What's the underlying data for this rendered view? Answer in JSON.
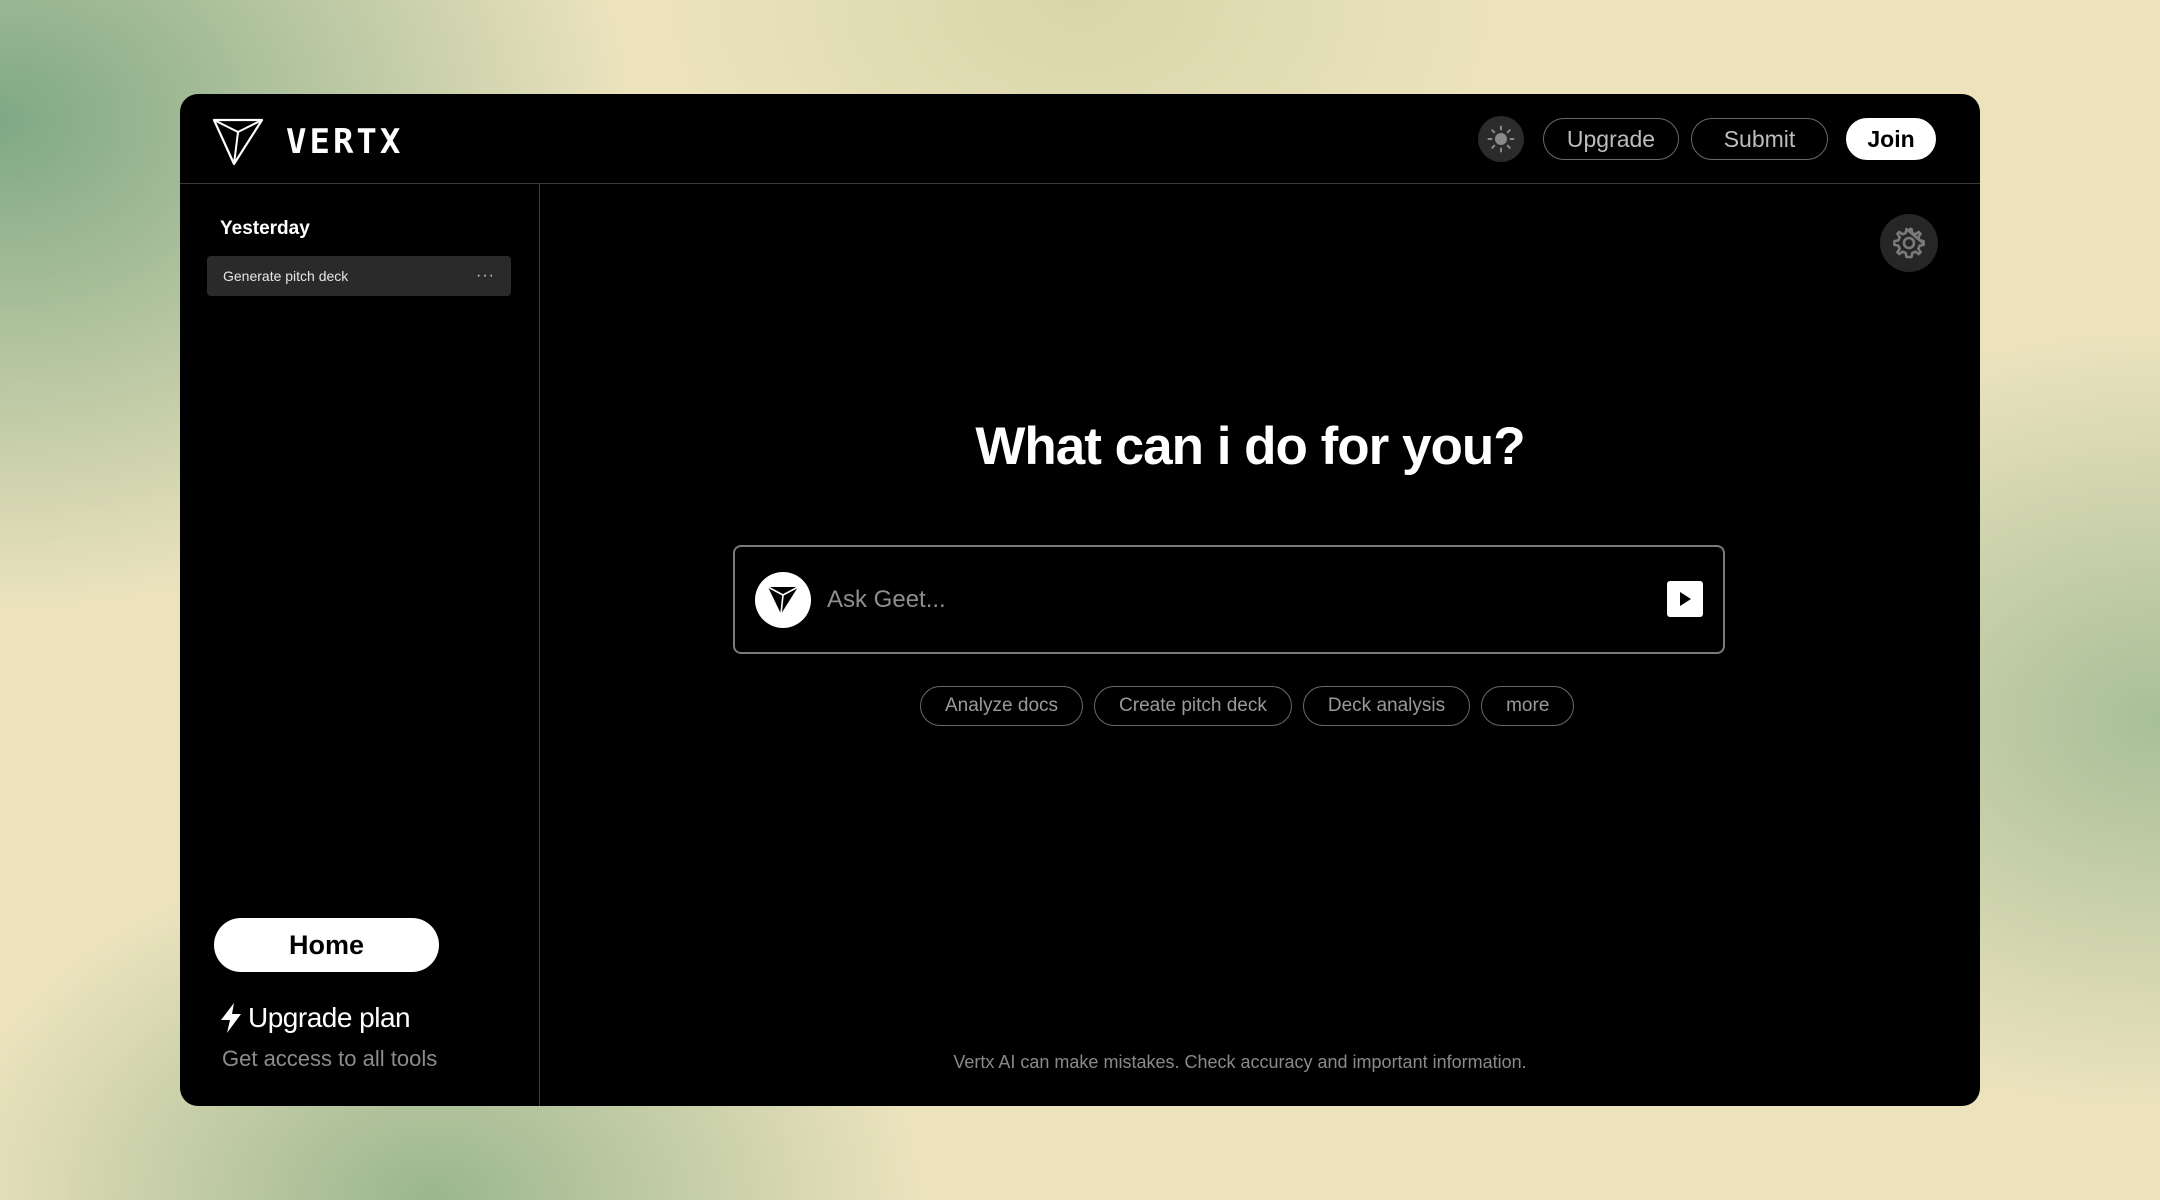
{
  "header": {
    "brand": "VERTX",
    "buttons": {
      "upgrade": "Upgrade",
      "submit": "Submit",
      "join": "Join"
    }
  },
  "sidebar": {
    "section_label": "Yesterday",
    "history": [
      {
        "label": "Generate pitch deck",
        "menu": "···"
      }
    ],
    "home_label": "Home",
    "upgrade_plan": {
      "title": "Upgrade plan",
      "subtitle": "Get access to all tools"
    }
  },
  "main": {
    "title": "What can i do for you?",
    "search": {
      "placeholder": "Ask Geet...",
      "value": ""
    },
    "chips": [
      {
        "label": "Analyze docs"
      },
      {
        "label": "Create pitch deck"
      },
      {
        "label": "Deck analysis"
      },
      {
        "label": "more"
      }
    ],
    "disclaimer": "Vertx AI can make mistakes. Check accuracy and important information."
  },
  "icons": {
    "logo": "triangle-logo-icon",
    "theme": "sun-icon",
    "settings": "gear-icon",
    "send": "play-icon",
    "upgrade": "lightning-icon"
  },
  "colors": {
    "window_bg": "#000000",
    "accent": "#ffffff",
    "muted_text": "#8e8e8e",
    "border": "#6a6a6a"
  }
}
